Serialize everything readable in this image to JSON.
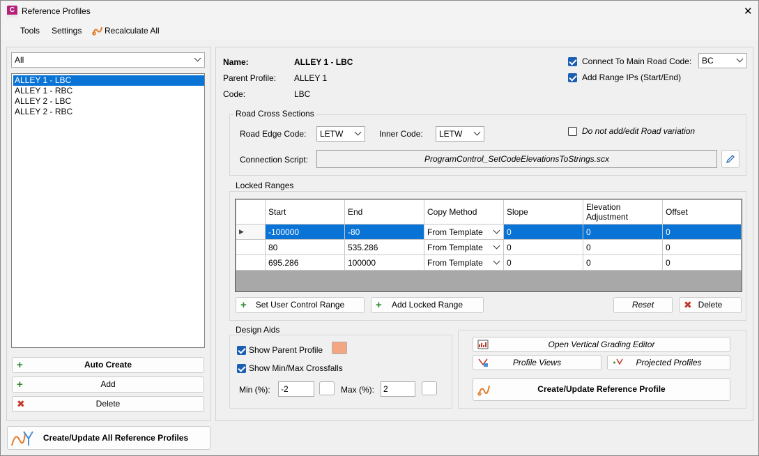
{
  "window": {
    "title": "Reference Profiles",
    "app_icon_letter": "C",
    "close_glyph": "✕"
  },
  "menu": {
    "tools": "Tools",
    "settings": "Settings",
    "recalculate": "Recalculate All"
  },
  "left": {
    "filter_value": "All",
    "profiles": [
      "ALLEY 1 - LBC",
      "ALLEY 1 - RBC",
      "ALLEY 2 - LBC",
      "ALLEY 2 - RBC"
    ],
    "selected_index": 0,
    "auto_create": "Auto Create",
    "add": "Add",
    "delete": "Delete",
    "create_all": "Create/Update All Reference Profiles"
  },
  "info": {
    "name_label": "Name:",
    "name_value": "ALLEY 1 - LBC",
    "parent_label": "Parent Profile:",
    "parent_value": "ALLEY 1",
    "code_label": "Code:",
    "code_value": "LBC",
    "connect_label": "Connect To Main Road Code:",
    "connect_value": "BC",
    "connect_checked": true,
    "range_ips_label": "Add Range IPs (Start/End)",
    "range_ips_checked": true
  },
  "road_cross": {
    "title": "Road Cross Sections",
    "edge_label": "Road Edge Code:",
    "edge_value": "LETW",
    "inner_label": "Inner Code:",
    "inner_value": "LETW",
    "no_variation_label": "Do not add/edit Road variation",
    "no_variation_checked": false,
    "script_label": "Connection Script:",
    "script_value": "ProgramControl_SetCodeElevationsToStrings.scx"
  },
  "locked": {
    "title": "Locked Ranges",
    "columns": [
      "Start",
      "End",
      "Copy Method",
      "Slope",
      "Elevation Adjustment",
      "Offset"
    ],
    "rows": [
      [
        "-100000",
        "-80",
        "From Template",
        "0",
        "0",
        "0"
      ],
      [
        "80",
        "535.286",
        "From Template",
        "0",
        "0",
        "0"
      ],
      [
        "695.286",
        "100000",
        "From Template",
        "0",
        "0",
        "0"
      ]
    ],
    "selected_row": 0,
    "set_user": "Set User Control Range",
    "add_locked": "Add Locked Range",
    "reset": "Reset",
    "delete": "Delete"
  },
  "design_aids": {
    "title": "Design Aids",
    "show_parent": "Show Parent Profile",
    "show_parent_checked": true,
    "parent_color": "#f4a582",
    "show_minmax": "Show Min/Max Crossfalls",
    "show_minmax_checked": true,
    "min_label": "Min (%):",
    "min_value": "-2",
    "max_label": "Max (%):",
    "max_value": "2"
  },
  "actions": {
    "vertical_grading": "Open Vertical Grading Editor",
    "profile_views": "Profile Views",
    "projected_profiles": "Projected Profiles",
    "create_update": "Create/Update Reference Profile"
  },
  "colors": {
    "selection": "#0a74d6",
    "accent": "#1a5fb4"
  }
}
